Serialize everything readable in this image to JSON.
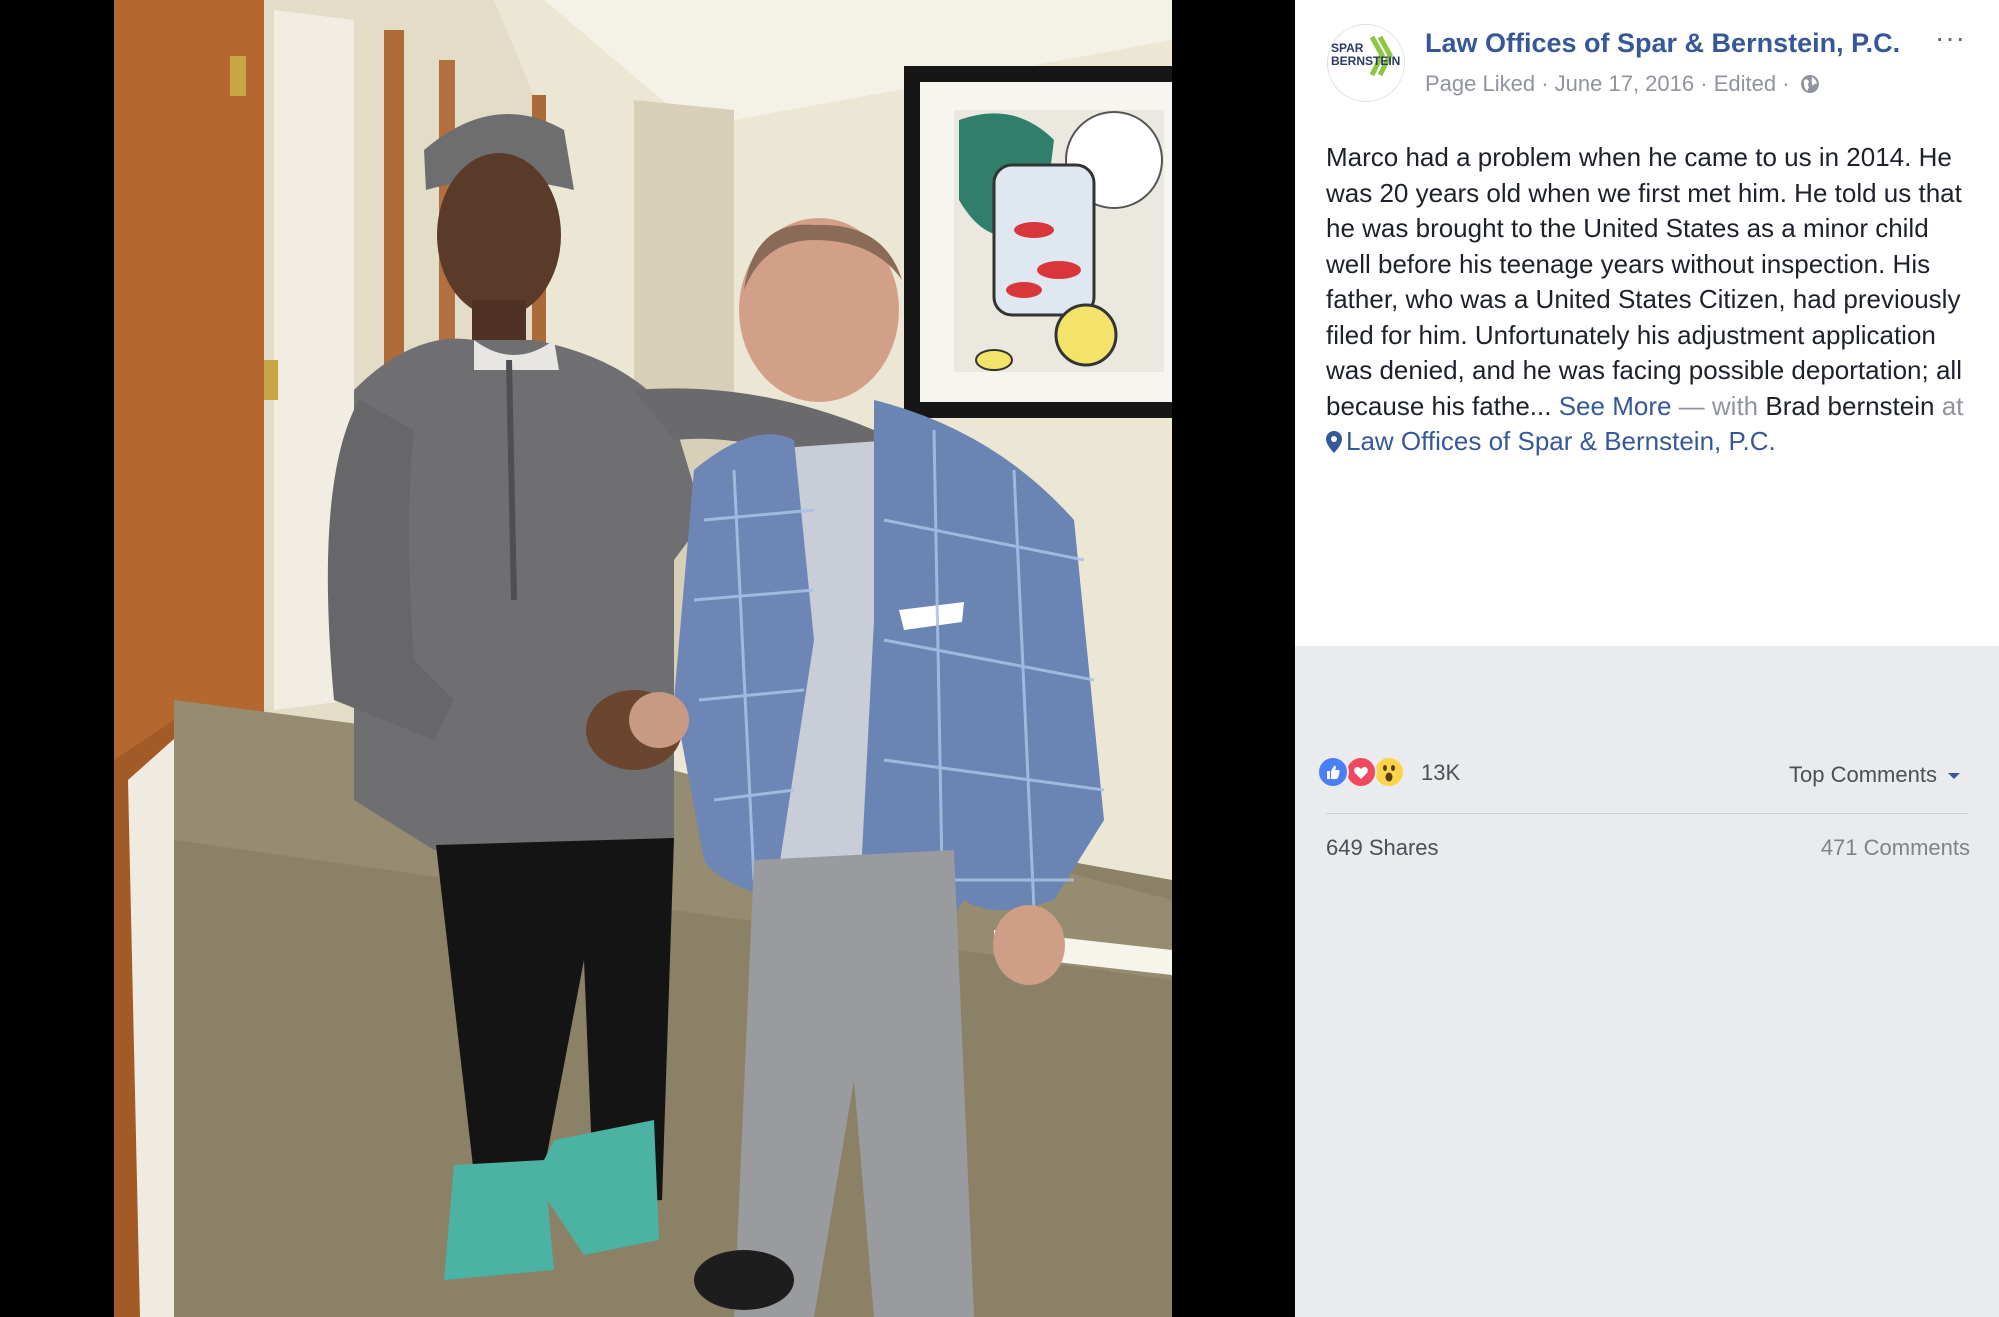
{
  "post": {
    "page_name": "Law Offices of Spar & Bernstein, P.C.",
    "avatar_text_line1": "SPAR",
    "avatar_text_line2": "BERNSTEIN",
    "status": "Page Liked",
    "date": "June 17, 2016",
    "edited": "Edited",
    "separator": " · ",
    "more_label": "···",
    "privacy_icon": "globe-icon",
    "body": "Marco had a problem when he came to us in 2014. He was 20 years old when we first met him. He told us that he was brought to the United States as a minor child well before his teenage years without inspection. His father, who was a United States Citizen, had previously filed for him. Unfortunately his adjustment application was denied, and he was facing possible deportation; all because his fathe...",
    "see_more": "See More",
    "with_prefix": " — with ",
    "tagged_person": "Brad bernstein",
    "at_label": " at ",
    "location": "Law Offices of Spar & Bernstein, P.C."
  },
  "engagement": {
    "reaction_icons": [
      "like-icon",
      "love-icon",
      "wow-icon"
    ],
    "reaction_count": "13K",
    "sort_label": "Top Comments",
    "shares": "649 Shares",
    "comments": "471 Comments"
  },
  "colors": {
    "link": "#365899",
    "like": "#4a7ff5",
    "love": "#f0485f",
    "wow": "#fbd44a",
    "panel_bottom": "#e9ebee",
    "logo_green": "#8dc63f"
  }
}
